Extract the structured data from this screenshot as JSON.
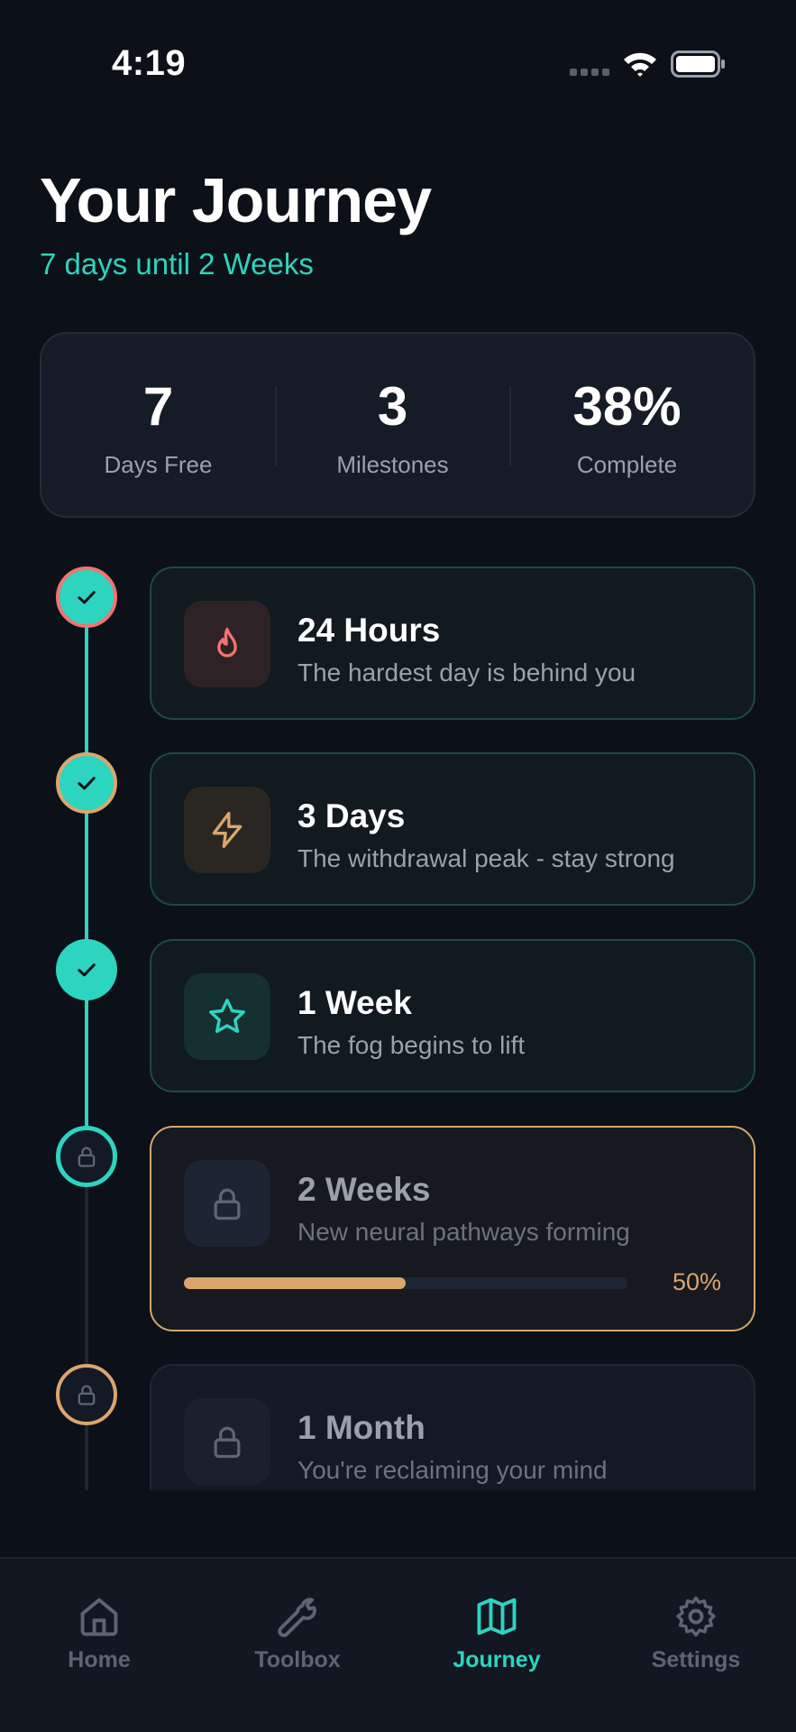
{
  "status_bar": {
    "time": "4:19"
  },
  "header": {
    "title": "Your Journey",
    "subtitle": "7 days until 2 Weeks"
  },
  "stats": [
    {
      "value": "7",
      "label": "Days Free"
    },
    {
      "value": "3",
      "label": "Milestones"
    },
    {
      "value": "38%",
      "label": "Complete"
    }
  ],
  "milestones": [
    {
      "title": "24 Hours",
      "description": "The hardest day is behind you",
      "icon": "flame-icon",
      "status": "completed",
      "accent": "#f07470"
    },
    {
      "title": "3 Days",
      "description": "The withdrawal peak - stay strong",
      "icon": "lightning-icon",
      "status": "completed",
      "accent": "#dba66c"
    },
    {
      "title": "1 Week",
      "description": "The fog begins to lift",
      "icon": "star-icon",
      "status": "completed",
      "accent": "#2dd4bf"
    },
    {
      "title": "2 Weeks",
      "description": "New neural pathways forming",
      "icon": "lock-icon",
      "status": "in-progress",
      "progress": 0.5,
      "progress_label": "50%"
    },
    {
      "title": "1 Month",
      "description": "You're reclaiming your mind",
      "icon": "lock-icon",
      "status": "locked"
    }
  ],
  "tab_bar": {
    "items": [
      {
        "label": "Home",
        "icon": "home-icon",
        "active": false
      },
      {
        "label": "Toolbox",
        "icon": "wrench-icon",
        "active": false
      },
      {
        "label": "Journey",
        "icon": "map-icon",
        "active": true
      },
      {
        "label": "Settings",
        "icon": "gear-icon",
        "active": false
      }
    ]
  },
  "colors": {
    "background": "#0c1018",
    "accent_teal": "#2dd4bf",
    "accent_orange": "#dba66c",
    "accent_red": "#f07470",
    "inactive": "#5d6472"
  }
}
